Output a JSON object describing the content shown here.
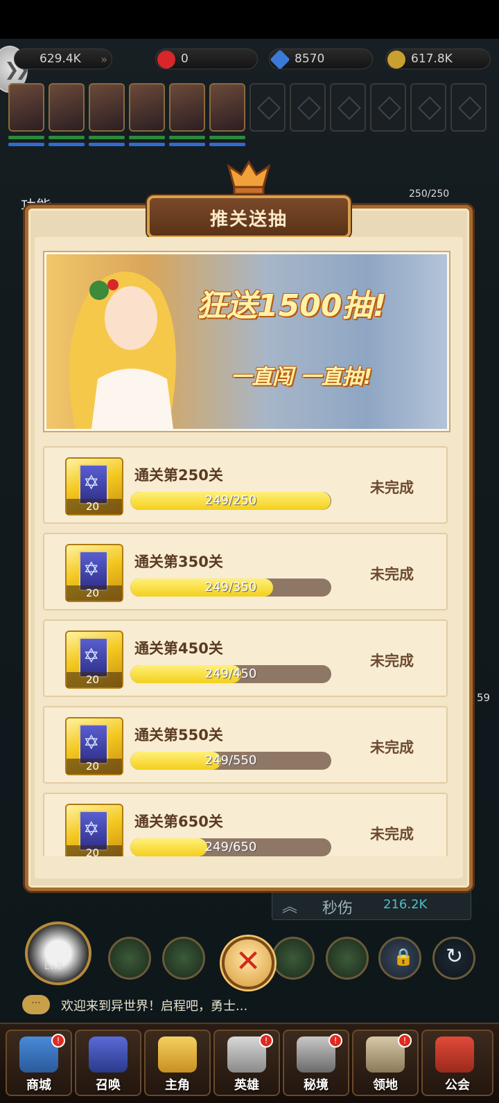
{
  "resources": [
    {
      "value": "629.4K",
      "icon": "power-icon",
      "color": "#8a8a8a"
    },
    {
      "value": "0",
      "icon": "ruby-icon",
      "color": "#d8262a"
    },
    {
      "value": "8570",
      "icon": "diamond-icon",
      "color": "#3a7ad8"
    },
    {
      "value": "617.8K",
      "icon": "gold-coin-icon",
      "color": "#c9a030"
    }
  ],
  "side": {
    "func_label": "功能",
    "boss_hp": "250/250",
    "timer_fragment": "59"
  },
  "dialog": {
    "title": "推关送抽",
    "banner_headline": "狂送1500抽!",
    "banner_sub": "一直闯 一直抽!",
    "tasks": [
      {
        "title": "通关第250关",
        "count": "20",
        "progress_text": "249/250",
        "progress": 0.996,
        "status": "未完成"
      },
      {
        "title": "通关第350关",
        "count": "20",
        "progress_text": "249/350",
        "progress": 0.711,
        "status": "未完成"
      },
      {
        "title": "通关第450关",
        "count": "20",
        "progress_text": "249/450",
        "progress": 0.553,
        "status": "未完成"
      },
      {
        "title": "通关第550关",
        "count": "20",
        "progress_text": "249/550",
        "progress": 0.453,
        "status": "未完成"
      },
      {
        "title": "通关第650关",
        "count": "20",
        "progress_text": "249/650",
        "progress": 0.383,
        "status": "未完成"
      }
    ]
  },
  "battle": {
    "dps_label": "秒伤",
    "dps_value": "216.2K",
    "level": "Lv.9"
  },
  "chat": {
    "icon_text": "···",
    "message": "欢迎来到异世界！启程吧，勇士..."
  },
  "nav": [
    {
      "label": "商城",
      "icon": "shop-icon",
      "badge": "!"
    },
    {
      "label": "召唤",
      "icon": "summon-cards-icon",
      "badge": ""
    },
    {
      "label": "主角",
      "icon": "crown-icon",
      "badge": ""
    },
    {
      "label": "英雄",
      "icon": "knight-helmet-icon",
      "badge": "!"
    },
    {
      "label": "秘境",
      "icon": "crossed-swords-icon",
      "badge": "!"
    },
    {
      "label": "领地",
      "icon": "castle-icon",
      "badge": "!"
    },
    {
      "label": "公会",
      "icon": "guild-flag-icon",
      "badge": ""
    }
  ],
  "colors": {
    "accent": "#d8a04a",
    "parchment": "#f3e6c9",
    "progress_fill": "#f4cf1c",
    "close_red": "#d12a1a"
  }
}
